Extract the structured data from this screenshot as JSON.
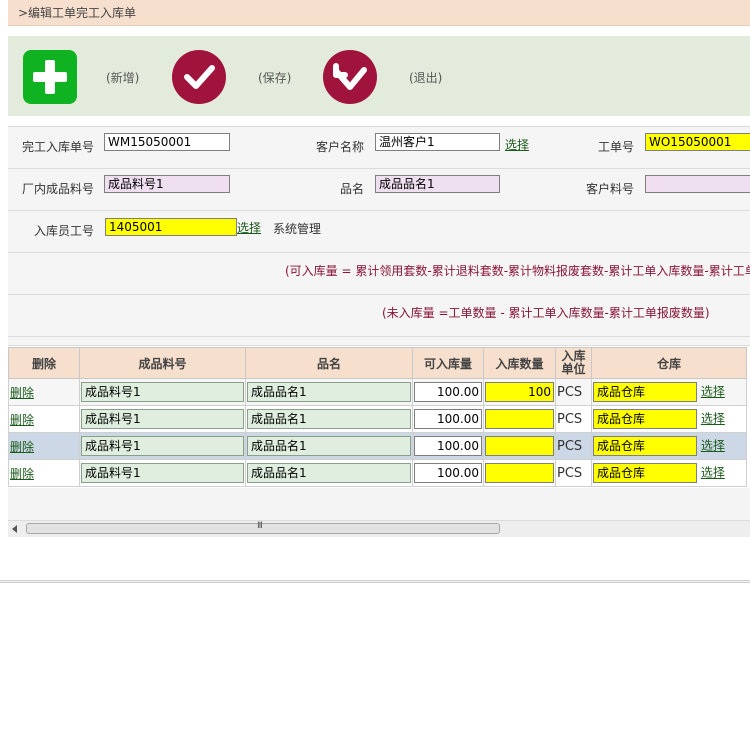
{
  "page_title": ">编辑工单完工入库单",
  "toolbar": {
    "add_label": "(新增)",
    "save_label": "(保存)",
    "exit_label": "(退出)"
  },
  "form": {
    "receipt_no_label": "完工入库单号",
    "receipt_no_value": "WM15050001",
    "customer_name_label": "客户名称",
    "customer_name_value": "温州客户1",
    "customer_select": "选择",
    "work_order_label": "工单号",
    "work_order_value": "WO15050001",
    "product_code_label": "厂内成品料号",
    "product_code_value": "成品料号1",
    "product_name_label": "品名",
    "product_name_value": "成品品名1",
    "customer_part_label": "客户料号",
    "customer_part_value": "",
    "staff_label": "入库员工号",
    "staff_value": "1405001",
    "staff_select": "选择",
    "staff_name": "系统管理"
  },
  "formulas": {
    "available": "(可入库量  = 累计领用套数-累计退料套数-累计物料报废套数-累计工单入库数量-累计工单",
    "pending": "(未入库量  =工单数量  - 累计工单入库数量-累计工单报废数量)"
  },
  "grid": {
    "headers": [
      "删除",
      "成品料号",
      "品名",
      "可入库量",
      "入库数量",
      "入库单位",
      "仓库"
    ],
    "rows": [
      {
        "delete": "删除",
        "code": "成品料号1",
        "name": "成品品名1",
        "available": "100.00",
        "qty": "100",
        "unit": "PCS",
        "warehouse": "成品仓库",
        "select": "选择"
      },
      {
        "delete": "删除",
        "code": "成品料号1",
        "name": "成品品名1",
        "available": "100.00",
        "qty": "",
        "unit": "PCS",
        "warehouse": "成品仓库",
        "select": "选择"
      },
      {
        "delete": "删除",
        "code": "成品料号1",
        "name": "成品品名1",
        "available": "100.00",
        "qty": "",
        "unit": "PCS",
        "warehouse": "成品仓库",
        "select": "选择"
      },
      {
        "delete": "删除",
        "code": "成品料号1",
        "name": "成品品名1",
        "available": "100.00",
        "qty": "",
        "unit": "PCS",
        "warehouse": "成品仓库",
        "select": "选择"
      }
    ]
  },
  "scrollbar": {
    "grip": "III"
  },
  "colors": {
    "accent_green": "#0fb321",
    "button_red": "#a0133d",
    "header_bg": "#f6dfcd",
    "toolbar_bg": "#e3ecdc",
    "highlight_yellow": "#ffff00"
  }
}
